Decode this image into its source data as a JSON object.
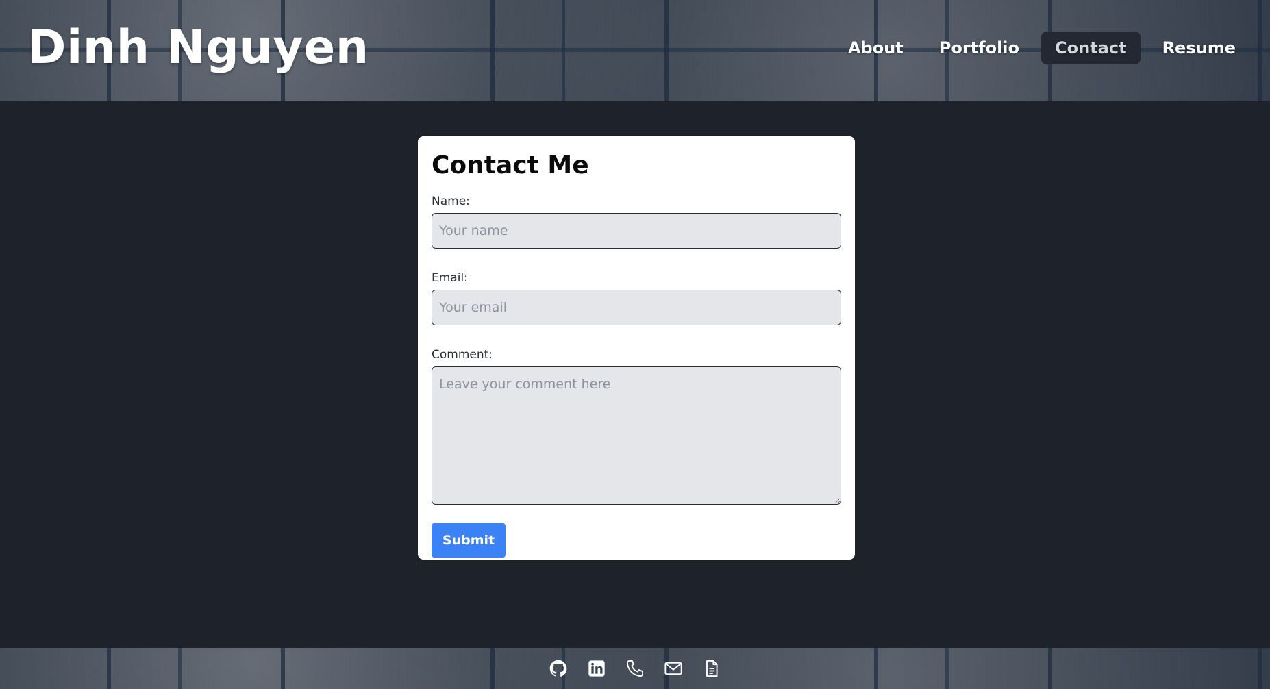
{
  "header": {
    "site_title": "Dinh Nguyen",
    "nav": [
      {
        "label": "About"
      },
      {
        "label": "Portfolio"
      },
      {
        "label": "Contact",
        "active": true
      },
      {
        "label": "Resume"
      }
    ]
  },
  "contact_form": {
    "title": "Contact Me",
    "name_label": "Name:",
    "name_placeholder": "Your name",
    "name_value": "",
    "email_label": "Email:",
    "email_placeholder": "Your email",
    "email_value": "",
    "comment_label": "Comment:",
    "comment_placeholder": "Leave your comment here",
    "comment_value": "",
    "submit_label": "Submit"
  },
  "footer": {
    "icons": [
      "github-icon",
      "linkedin-icon",
      "phone-icon",
      "mail-icon",
      "document-icon"
    ]
  },
  "colors": {
    "background": "#1e222a",
    "card": "#ffffff",
    "input_bg": "#e5e6ea",
    "accent": "#3b82f6",
    "active_nav": "#232832"
  }
}
